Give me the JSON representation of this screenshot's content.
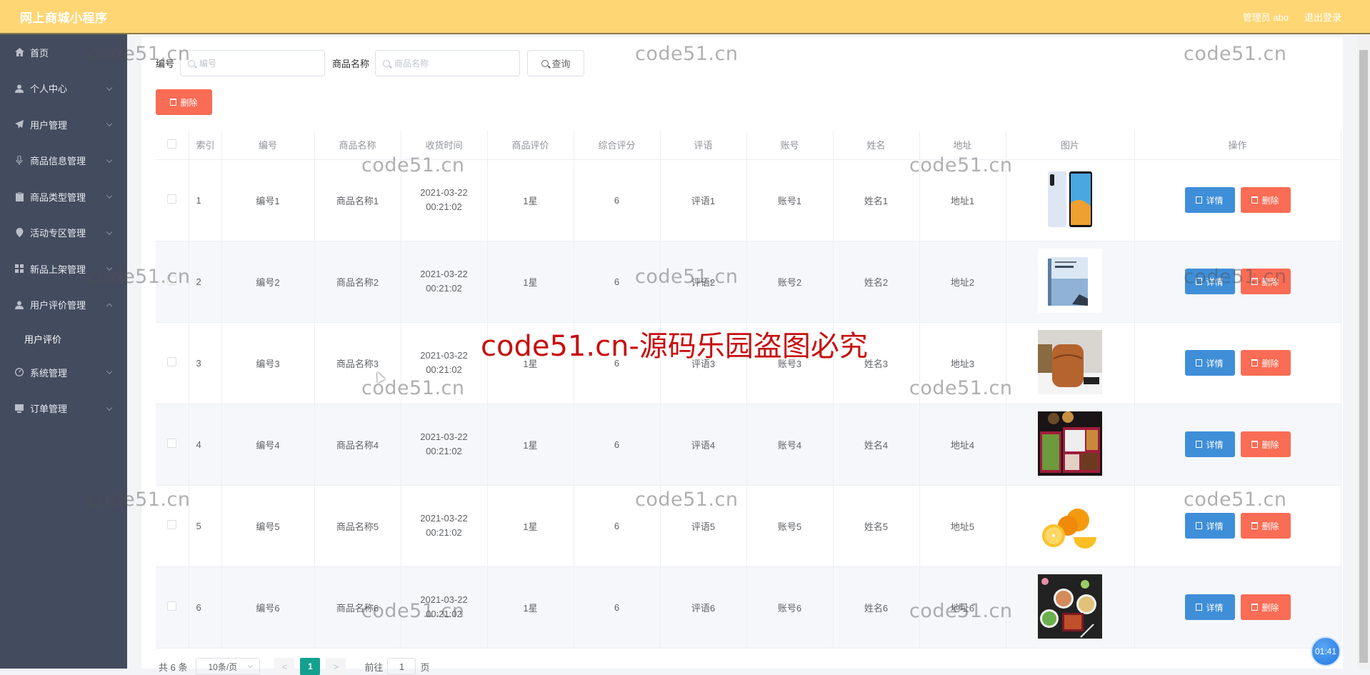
{
  "header": {
    "title": "网上商城小程序",
    "user_label": "管理员 abo",
    "logout_label": "退出登录"
  },
  "sidebar": {
    "items": [
      {
        "label": "首页",
        "icon": "home-icon",
        "expandable": false
      },
      {
        "label": "个人中心",
        "icon": "user-icon",
        "expandable": true
      },
      {
        "label": "用户管理",
        "icon": "send-icon",
        "expandable": true
      },
      {
        "label": "商品信息管理",
        "icon": "microphone-icon",
        "expandable": true
      },
      {
        "label": "商品类型管理",
        "icon": "clipboard-icon",
        "expandable": true
      },
      {
        "label": "活动专区管理",
        "icon": "location-icon",
        "expandable": true
      },
      {
        "label": "新品上架管理",
        "icon": "grid-icon",
        "expandable": true
      },
      {
        "label": "用户评价管理",
        "icon": "user-icon",
        "expandable": true,
        "expanded": true
      },
      {
        "label": "系统管理",
        "icon": "gauge-icon",
        "expandable": true
      },
      {
        "label": "订单管理",
        "icon": "monitor-icon",
        "expandable": true
      }
    ],
    "subitem": "用户评价"
  },
  "search": {
    "code_label": "编号",
    "code_placeholder": "编号",
    "name_label": "商品名称",
    "name_placeholder": "商品名称",
    "query_button": "查询"
  },
  "toolbar": {
    "delete_label": "删除"
  },
  "table": {
    "columns": [
      "索引",
      "编号",
      "商品名称",
      "收货时间",
      "商品评价",
      "综合评分",
      "评语",
      "账号",
      "姓名",
      "地址",
      "图片",
      "操作"
    ],
    "rows": [
      {
        "index": "1",
        "code": "编号1",
        "name": "商品名称1",
        "time": "2021-03-22 00:21:02",
        "rating": "1星",
        "score": "6",
        "comment": "评语1",
        "account": "账号1",
        "person": "姓名1",
        "address": "地址1",
        "image": "phone"
      },
      {
        "index": "2",
        "code": "编号2",
        "name": "商品名称2",
        "time": "2021-03-22 00:21:02",
        "rating": "1星",
        "score": "6",
        "comment": "评语2",
        "account": "账号2",
        "person": "姓名2",
        "address": "地址2",
        "image": "book"
      },
      {
        "index": "3",
        "code": "编号3",
        "name": "商品名称3",
        "time": "2021-03-22 00:21:02",
        "rating": "1星",
        "score": "6",
        "comment": "评语3",
        "account": "账号3",
        "person": "姓名3",
        "address": "地址3",
        "image": "leather-bag"
      },
      {
        "index": "4",
        "code": "编号4",
        "name": "商品名称4",
        "time": "2021-03-22 00:21:02",
        "rating": "1星",
        "score": "6",
        "comment": "评语4",
        "account": "账号4",
        "person": "姓名4",
        "address": "地址4",
        "image": "bento-box"
      },
      {
        "index": "5",
        "code": "编号5",
        "name": "商品名称5",
        "time": "2021-03-22 00:21:02",
        "rating": "1星",
        "score": "6",
        "comment": "评语5",
        "account": "账号5",
        "person": "姓名5",
        "address": "地址5",
        "image": "oranges"
      },
      {
        "index": "6",
        "code": "编号6",
        "name": "商品名称6",
        "time": "2021-03-22 00:21:02",
        "rating": "1星",
        "score": "6",
        "comment": "评语6",
        "account": "账号6",
        "person": "姓名6",
        "address": "地址6",
        "image": "japanese-meal"
      }
    ],
    "detail_label": "详情",
    "delete_label": "删除"
  },
  "pagination": {
    "total_text": "共 6 条",
    "page_size": "10条/页",
    "prev": "<",
    "current": "1",
    "next": ">",
    "goto_label": "前往",
    "goto_value": "1",
    "page_suffix": "页"
  },
  "timer": "01:41",
  "watermarks": {
    "small": "code51.cn",
    "big": "code51.cn-源码乐园盗图必究"
  },
  "colors": {
    "header": "#fed674",
    "sidebar": "#434c5e",
    "detail_button": "#3f8ed8",
    "delete_button": "#f96c55",
    "active_page": "#13a08f"
  }
}
